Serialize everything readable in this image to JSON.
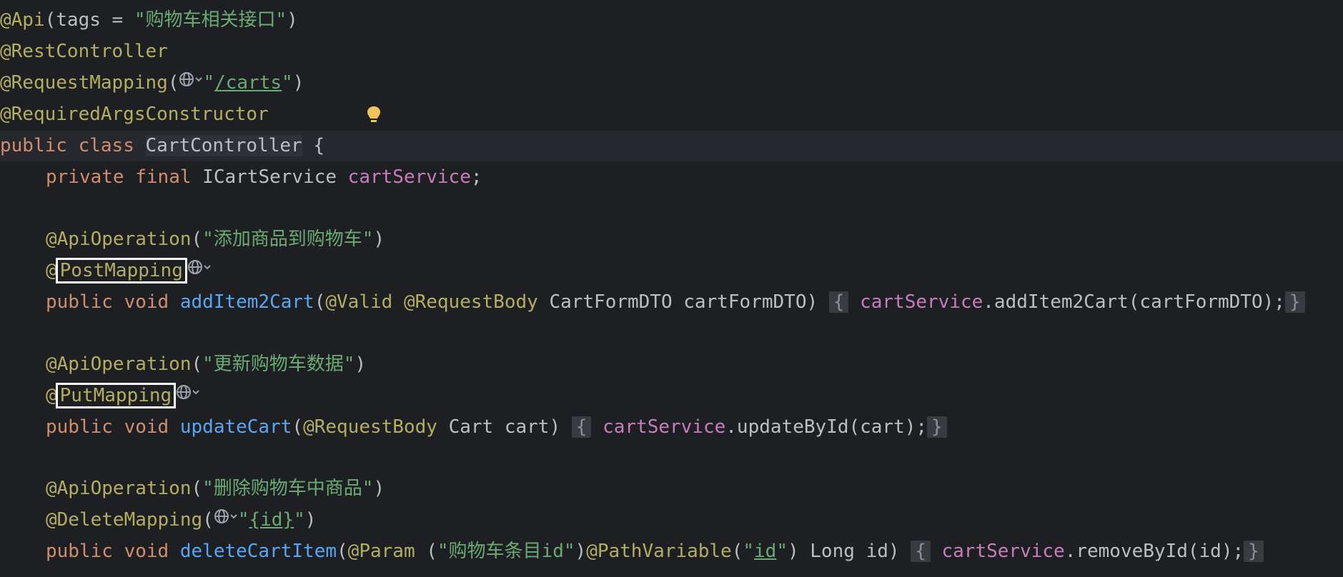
{
  "class_block": {
    "api_tags_ann": "@Api",
    "api_tags_open": "(tags = ",
    "api_tags_value": "\"购物车相关接口\"",
    "api_tags_close": ")",
    "rest_controller": "@RestController",
    "request_mapping_ann": "@RequestMapping",
    "request_mapping_open": "(",
    "request_mapping_path_q1": "\"",
    "request_mapping_path": "/carts",
    "request_mapping_path_q2": "\"",
    "request_mapping_close": ")",
    "required_args": "@RequiredArgsConstructor",
    "decl_public": "public",
    "decl_class": "class",
    "class_name": "CartController",
    "decl_brace": "{",
    "field_private": "private",
    "field_final": "final",
    "field_type": "ICartService",
    "field_name": "cartService",
    "field_semicolon": ";"
  },
  "methods": [
    {
      "op_ann": "@ApiOperation",
      "op_open": "(",
      "op_value": "\"添加商品到购物车\"",
      "op_close": ")",
      "at": "@",
      "mapping": "PostMapping",
      "sig_public": "public",
      "sig_void": "void",
      "name": "addItem2Cart",
      "paren_open": "(",
      "param_ann1": "@Valid",
      "param_ann2": "@RequestBody",
      "param_type": "CartFormDTO",
      "param_name": "cartFormDTO",
      "paren_close": ")",
      "body_open": "{",
      "call_target": "cartService",
      "call_rest": ".addItem2Cart(cartFormDTO);",
      "body_close": "}"
    },
    {
      "op_ann": "@ApiOperation",
      "op_open": "(",
      "op_value": "\"更新购物车数据\"",
      "op_close": ")",
      "at": "@",
      "mapping": "PutMapping",
      "sig_public": "public",
      "sig_void": "void",
      "name": "updateCart",
      "paren_open": "(",
      "param_ann1": "@RequestBody",
      "param_type": "Cart",
      "param_name": "cart",
      "paren_close": ")",
      "body_open": "{",
      "call_target": "cartService",
      "call_rest": ".updateById(cart);",
      "body_close": "}"
    },
    {
      "op_ann": "@ApiOperation",
      "op_open": "(",
      "op_value": "\"删除购物车中商品\"",
      "op_close": ")",
      "mapping_ann": "@DeleteMapping",
      "mapping_open": "(",
      "mapping_q1": "\"",
      "mapping_path": "{id}",
      "mapping_q2": "\"",
      "mapping_close": ")",
      "sig_public": "public",
      "sig_void": "void",
      "name": "deleteCartItem",
      "paren_open": "(",
      "param_ann1": "@Param",
      "param_ann1_open": " (",
      "param_ann1_value_a": "\"购物车条目",
      "param_ann1_value_b": "id\"",
      "param_ann1_close": ")",
      "param_ann2": "@PathVariable",
      "param_ann2_open": "(",
      "param_ann2_q1": "\"",
      "param_ann2_value": "id",
      "param_ann2_q2": "\"",
      "param_ann2_close": ")",
      "param_type": "Long",
      "param_name": "id",
      "paren_close": ")",
      "body_open": "{",
      "call_target": "cartService",
      "call_rest": ".removeById(id);",
      "body_close": "}"
    }
  ],
  "icons": {
    "web_endpoint": "globe-dropdown-icon",
    "intention": "lightbulb-icon"
  },
  "colors": {
    "background": "#1e1f22",
    "annotation": "#b3ae60",
    "keyword": "#cf8e6d",
    "string": "#6aab73",
    "field": "#c77dbb",
    "method": "#56a8f5",
    "text": "#bcbec4"
  }
}
